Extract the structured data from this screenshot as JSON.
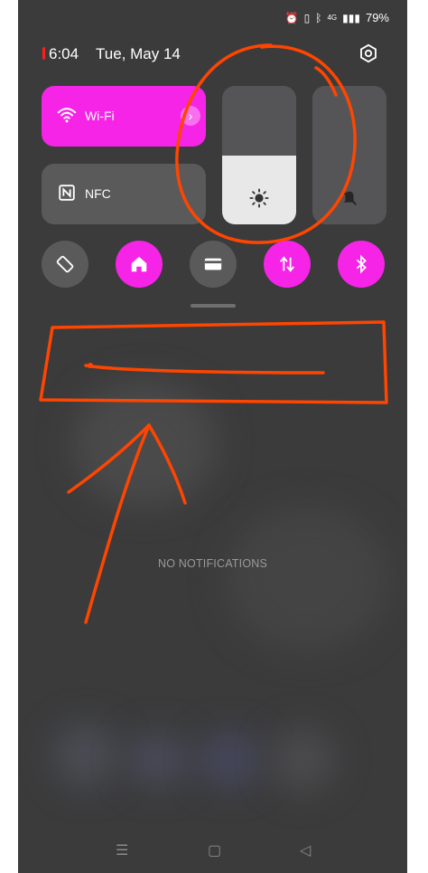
{
  "status": {
    "battery": "79%",
    "network": "4G",
    "icons": [
      "alarm-icon",
      "vibrate-icon",
      "bluetooth-icon",
      "signal-icon"
    ]
  },
  "header": {
    "time": "6:04",
    "date": "Tue, May 14",
    "settings_icon": "gear-icon"
  },
  "tiles": {
    "wifi": {
      "label": "Wi-Fi",
      "icon": "wifi-icon",
      "active": true
    },
    "nfc": {
      "label": "NFC",
      "icon": "nfc-icon",
      "active": false
    }
  },
  "sliders": {
    "brightness": {
      "level": 0.5,
      "icon": "brightness-icon"
    },
    "volume": {
      "level": 0,
      "icon": "mute-icon"
    }
  },
  "toggles": [
    {
      "icon": "auto-rotate-icon",
      "active": false
    },
    {
      "icon": "home-icon",
      "active": true
    },
    {
      "icon": "card-icon",
      "active": false
    },
    {
      "icon": "mobile-data-icon",
      "active": true
    },
    {
      "icon": "bluetooth-icon",
      "active": true
    }
  ],
  "notifications": {
    "empty_text": "NO NOTIFICATIONS"
  },
  "navbar": {
    "icons": [
      "recents-icon",
      "home-nav-icon",
      "back-icon"
    ]
  },
  "colors": {
    "accent": "#f624e6",
    "panel_bg": "#3b3b3c",
    "annotation": "#ff4500"
  }
}
